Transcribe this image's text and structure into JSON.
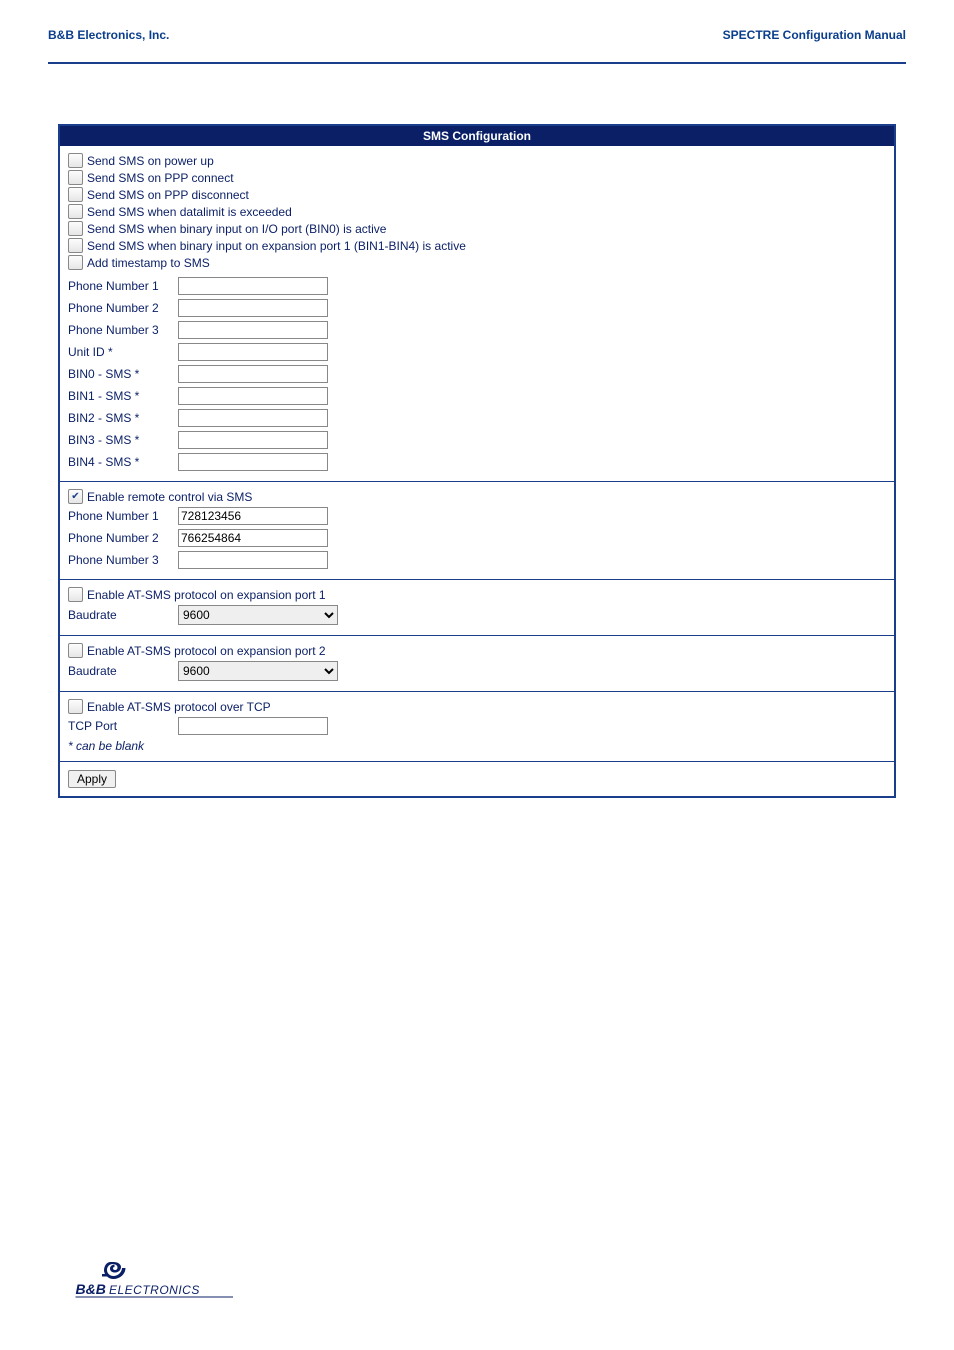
{
  "header": {
    "left": "B&B Electronics, Inc.",
    "right": "SPECTRE Configuration Manual"
  },
  "panel": {
    "title": "SMS Configuration"
  },
  "section1": {
    "cb_powerup": "Send SMS on power up",
    "cb_ppp_connect": "Send SMS on PPP connect",
    "cb_ppp_disconnect": "Send SMS on PPP disconnect",
    "cb_datalimit": "Send SMS when datalimit is exceeded",
    "cb_bin0": "Send SMS when binary input on I/O port (BIN0) is active",
    "cb_bin14": "Send SMS when binary input on expansion port 1 (BIN1-BIN4) is active",
    "cb_timestamp": "Add timestamp to SMS",
    "phone1_label": "Phone Number 1",
    "phone1_value": "",
    "phone2_label": "Phone Number 2",
    "phone2_value": "",
    "phone3_label": "Phone Number 3",
    "phone3_value": "",
    "unitid_label": "Unit ID *",
    "unitid_value": "",
    "bin0_label": "BIN0 - SMS *",
    "bin0_value": "",
    "bin1_label": "BIN1 - SMS *",
    "bin1_value": "",
    "bin2_label": "BIN2 - SMS *",
    "bin2_value": "",
    "bin3_label": "BIN3 - SMS *",
    "bin3_value": "",
    "bin4_label": "BIN4 - SMS *",
    "bin4_value": ""
  },
  "section2": {
    "cb_remote": "Enable remote control via SMS",
    "phone1_label": "Phone Number 1",
    "phone1_value": "728123456",
    "phone2_label": "Phone Number 2",
    "phone2_value": "766254864",
    "phone3_label": "Phone Number 3",
    "phone3_value": ""
  },
  "section3": {
    "cb_port1": "Enable AT-SMS protocol on expansion port 1",
    "baud_label": "Baudrate",
    "baud_value": "9600"
  },
  "section4": {
    "cb_port2": "Enable AT-SMS protocol on expansion port 2",
    "baud_label": "Baudrate",
    "baud_value": "9600"
  },
  "section5": {
    "cb_tcp": "Enable AT-SMS protocol over TCP",
    "tcp_label": "TCP Port",
    "tcp_value": "",
    "footnote": "* can be blank"
  },
  "apply": {
    "label": "Apply"
  },
  "logo": {
    "line1": "B&B",
    "line2": "ELECTRONICS"
  }
}
